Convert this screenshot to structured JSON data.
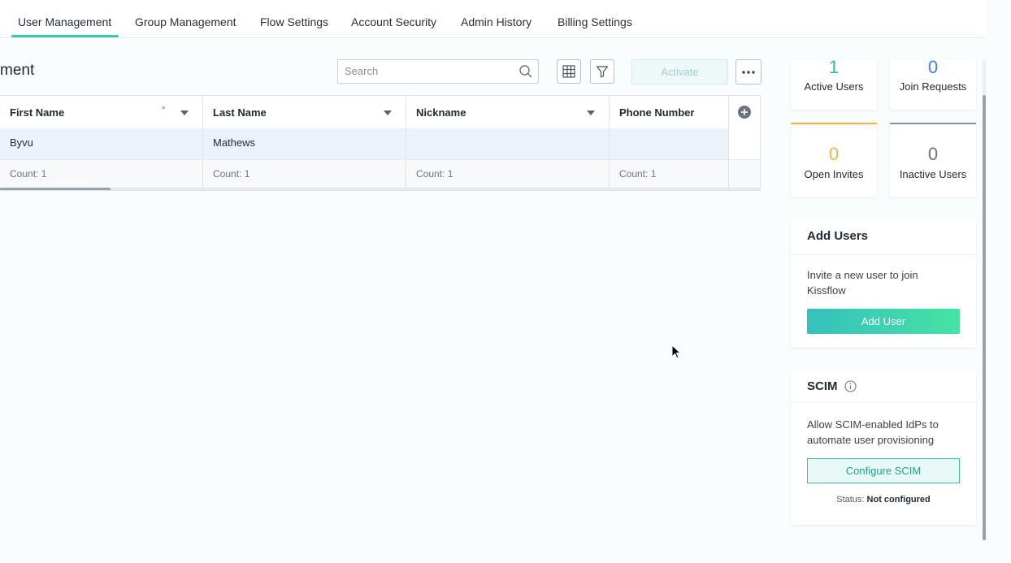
{
  "tabs": [
    {
      "label": "User Management"
    },
    {
      "label": "Group Management"
    },
    {
      "label": "Flow Settings"
    },
    {
      "label": "Account Security"
    },
    {
      "label": "Admin History"
    },
    {
      "label": "Billing Settings"
    }
  ],
  "page": {
    "title": "ment"
  },
  "toolbar": {
    "search_placeholder": "Search",
    "activate_label": "Activate"
  },
  "table": {
    "columns": [
      {
        "label": "First Name",
        "required": "*"
      },
      {
        "label": "Last Name"
      },
      {
        "label": "Nickname"
      },
      {
        "label": "Phone Number"
      }
    ],
    "rows": [
      {
        "first_name": "Byvu",
        "last_name": "Mathews",
        "nickname": "",
        "phone": ""
      }
    ],
    "counts": [
      "Count: 1",
      "Count: 1",
      "Count: 1",
      "Count: 1"
    ]
  },
  "stats": {
    "active": {
      "value": "1",
      "label": "Active Users",
      "color": "#2fbf8f"
    },
    "join": {
      "value": "0",
      "label": "Join Requests",
      "color": "#3b82f6"
    },
    "invites": {
      "value": "0",
      "label": "Open Invites",
      "color": "#f2b63c"
    },
    "inactive": {
      "value": "0",
      "label": "Inactive Users",
      "color": "#6b7280"
    }
  },
  "add_users": {
    "title": "Add Users",
    "description": "Invite a new user to join Kissflow",
    "button": "Add User"
  },
  "scim": {
    "title": "SCIM",
    "description": "Allow SCIM-enabled IdPs to automate user provisioning",
    "button": "Configure SCIM",
    "status_label": "Status:",
    "status_value": "Not configured"
  }
}
